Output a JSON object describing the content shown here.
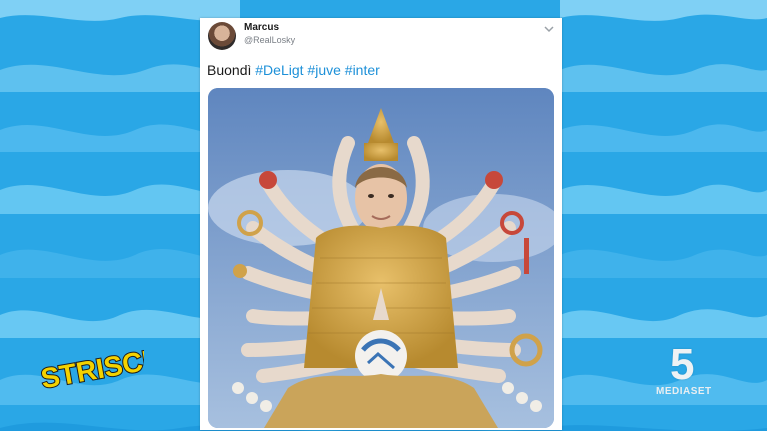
{
  "tweet": {
    "user_name": "Marcus",
    "user_handle": "@RealLosky",
    "text_prefix": "Buondì",
    "hashtags": [
      "#DeLigt",
      "#juve",
      "#inter"
    ]
  },
  "branding": {
    "striscia_logo": "STRISCIA",
    "channel_number": "5",
    "channel_network": "MEDIASET"
  },
  "colors": {
    "background": "#2aa7e6",
    "hashtag": "#1d90d8",
    "card": "#ffffff"
  },
  "icons": [
    "avatar",
    "chevron-down-icon",
    "wave-background",
    "striscia-logo",
    "canale5-logo"
  ]
}
